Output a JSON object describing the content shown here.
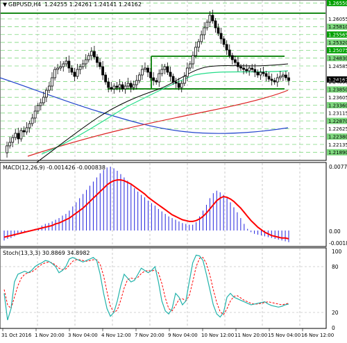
{
  "main": {
    "symbol": "GBPUSD,H4",
    "ohlc": "1.24255 1.24261 1.24141 1.24162",
    "price_labels": [
      "1.26550",
      "1.26055",
      "1.25810",
      "1.25565",
      "1.25320",
      "1.25075",
      "1.24830",
      "1.24585",
      "1.24162",
      "1.24095",
      "1.23850",
      "1.23605",
      "1.23360",
      "1.23115",
      "1.22870",
      "1.22625",
      "1.22380",
      "1.22135",
      "1.21890"
    ],
    "current_price": "1.24162",
    "current_price_index": 8
  },
  "macd": {
    "title": "MACD(12,26,9) -0.001426 -0.000838",
    "top_label": "0.007757",
    "zero_label": "0.00",
    "bottom_label": "-0.001863",
    "histogram": [
      -0.0012,
      -0.001,
      -0.0009,
      -0.0007,
      -0.0005,
      -0.0003,
      -0.0002,
      -0.0001,
      0.0,
      0.0002,
      0.0003,
      0.0006,
      0.0008,
      0.0009,
      0.0011,
      0.0013,
      0.0015,
      0.0018,
      0.002,
      0.0024,
      0.0029,
      0.0034,
      0.0039,
      0.0044,
      0.0049,
      0.0054,
      0.0059,
      0.0064,
      0.0069,
      0.0073,
      0.0076,
      0.0077,
      0.0075,
      0.0072,
      0.0068,
      0.0064,
      0.006,
      0.0055,
      0.0051,
      0.0047,
      0.0043,
      0.004,
      0.0036,
      0.0033,
      0.003,
      0.0026,
      0.0023,
      0.002,
      0.0017,
      0.0015,
      0.0013,
      0.0011,
      0.0009,
      0.0008,
      0.0007,
      0.0007,
      0.001,
      0.0017,
      0.0024,
      0.0031,
      0.0039,
      0.0045,
      0.0048,
      0.0046,
      0.0043,
      0.0039,
      0.0034,
      0.0028,
      0.0022,
      0.0015,
      0.0008,
      0.0002,
      -0.0002,
      -0.0004,
      -0.0005,
      -0.0006,
      -0.0007,
      -0.0008,
      -0.0009,
      -0.001,
      -0.0011,
      -0.0012,
      -0.0013,
      -0.0014
    ],
    "signal": [
      -0.0008,
      -0.0007,
      -0.0006,
      -0.0005,
      -0.0004,
      -0.0003,
      -0.0002,
      -0.0001,
      0.0,
      0.0001,
      0.0002,
      0.0003,
      0.0004,
      0.0005,
      0.0006,
      0.0008,
      0.0009,
      0.0011,
      0.0013,
      0.0015,
      0.0018,
      0.0021,
      0.0024,
      0.0027,
      0.0031,
      0.0035,
      0.0039,
      0.0043,
      0.0047,
      0.0051,
      0.0055,
      0.0058,
      0.006,
      0.0061,
      0.0061,
      0.006,
      0.0058,
      0.0056,
      0.0053,
      0.005,
      0.0047,
      0.0044,
      0.004,
      0.0037,
      0.0034,
      0.0031,
      0.0028,
      0.0025,
      0.0022,
      0.0019,
      0.0017,
      0.0015,
      0.0013,
      0.0012,
      0.0011,
      0.0011,
      0.0012,
      0.0014,
      0.0017,
      0.0021,
      0.0026,
      0.0031,
      0.0036,
      0.0039,
      0.0041,
      0.004,
      0.0038,
      0.0035,
      0.0031,
      0.0027,
      0.0022,
      0.0017,
      0.0012,
      0.0008,
      0.0004,
      0.0001,
      -0.0002,
      -0.0004,
      -0.0006,
      -0.0007,
      -0.0008,
      -0.0009,
      -0.0009,
      -0.001
    ]
  },
  "stoch": {
    "title": "Stoch(13,3,3) 30.8869 34.8982",
    "levels": [
      "100",
      "80",
      "20",
      "0"
    ],
    "main": [
      45,
      10,
      25,
      60,
      70,
      72,
      74,
      72,
      75,
      80,
      83,
      85,
      88,
      87,
      84,
      80,
      72,
      75,
      80,
      90,
      92,
      90,
      88,
      86,
      88,
      90,
      92,
      88,
      70,
      45,
      25,
      15,
      20,
      35,
      55,
      70,
      65,
      60,
      62,
      70,
      78,
      75,
      72,
      75,
      80,
      60,
      35,
      22,
      18,
      25,
      45,
      40,
      30,
      35,
      60,
      85,
      95,
      94,
      88,
      70,
      50,
      30,
      18,
      14,
      20,
      40,
      45,
      40,
      38,
      36,
      34,
      32,
      30,
      31,
      32,
      33,
      34,
      31,
      29,
      28,
      27,
      28,
      30,
      31
    ],
    "signal": [
      50,
      30,
      25,
      40,
      55,
      65,
      70,
      72,
      73,
      76,
      80,
      83,
      85,
      86,
      85,
      82,
      78,
      76,
      77,
      82,
      87,
      89,
      89,
      88,
      87,
      88,
      89,
      89,
      83,
      68,
      47,
      28,
      20,
      23,
      36,
      52,
      63,
      65,
      64,
      66,
      71,
      74,
      75,
      74,
      76,
      72,
      58,
      39,
      25,
      22,
      29,
      37,
      38,
      35,
      42,
      60,
      80,
      91,
      92,
      84,
      69,
      50,
      33,
      21,
      17,
      25,
      35,
      41,
      42,
      39,
      36,
      34,
      32,
      31,
      31,
      32,
      33,
      34,
      33,
      32,
      31,
      30,
      31,
      32
    ]
  },
  "time_labels": [
    "31 Oct 2016",
    "1 Nov 20:00",
    "3 Nov 04:00",
    "4 Nov 12:00",
    "7 Nov 20:00",
    "9 Nov 04:00",
    "10 Nov 12:00",
    "11 Nov 20:00",
    "15 Nov 04:00",
    "16 Nov 12:00"
  ],
  "colors": {
    "grid": "#a8a8a8",
    "level_green": "#1a8a1a",
    "level_dash": "#7ed87e",
    "candle": "#000000",
    "ma_black": "#000000",
    "ma_green": "#22dd88",
    "ma_red": "#dd2222",
    "ma_blue": "#2244cc",
    "macd_hist": "#2222dd",
    "macd_signal": "#ff0000",
    "stoch_main": "#20b2aa",
    "stoch_signal": "#ff0000",
    "label_green_bg": "#00a000",
    "label_current_bg": "#000000"
  }
}
